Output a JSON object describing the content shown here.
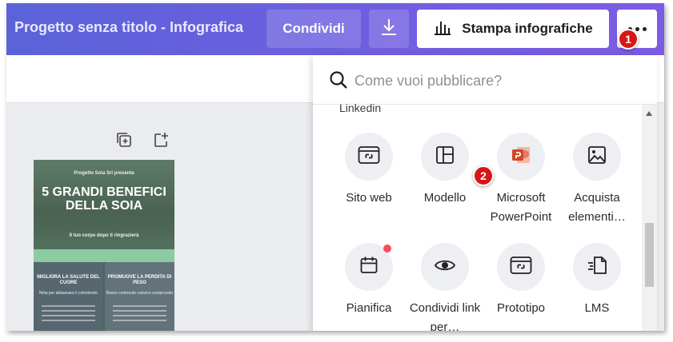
{
  "topbar": {
    "title": "Progetto senza titolo - Infografica",
    "share_label": "Condividi",
    "download_icon": "download-icon",
    "print_label": "Stampa infografiche",
    "print_icon": "bar-chart-icon",
    "more_icon": "more-dots-icon"
  },
  "badges": {
    "first": "1",
    "second": "2"
  },
  "colors": {
    "topbar_gradient_start": "#5a63d8",
    "topbar_gradient_end": "#7c5be3",
    "badge": "#d71616",
    "notify_dot": "#ff4a5a"
  },
  "canvas": {
    "duplicate_icon": "duplicate-page-icon",
    "add_page_icon": "add-page-icon",
    "thumbnail": {
      "presenta": "Progetto Soia Srl presenta",
      "heading": "5 GRANDI BENEFICI DELLA SOIA",
      "subheading": "Il tuo corpo dopo ti ringrazierà",
      "left_title": "MIGLIORA LA SALUTE DEL CUORE",
      "left_note": "Nota per abbassare il colesterolo",
      "right_title": "PROMUOVE LA PERDITA DI PESO",
      "right_note": "Basso contenuto calorico comprovato"
    }
  },
  "dropdown": {
    "search_placeholder": "Come vuoi pubblicare?",
    "partial_item": "Linkedin",
    "items": [
      {
        "label": "Sito web",
        "icon": "website-icon"
      },
      {
        "label": "Modello",
        "icon": "template-icon"
      },
      {
        "label": "Microsoft PowerPoint",
        "icon": "powerpoint-icon"
      },
      {
        "label": "Acquista elementi…",
        "icon": "image-icon"
      },
      {
        "label": "Pianifica",
        "icon": "calendar-icon"
      },
      {
        "label": "Condividi link per…",
        "icon": "eye-icon"
      },
      {
        "label": "Prototipo",
        "icon": "prototype-icon"
      },
      {
        "label": "LMS",
        "icon": "lms-icon"
      }
    ]
  }
}
